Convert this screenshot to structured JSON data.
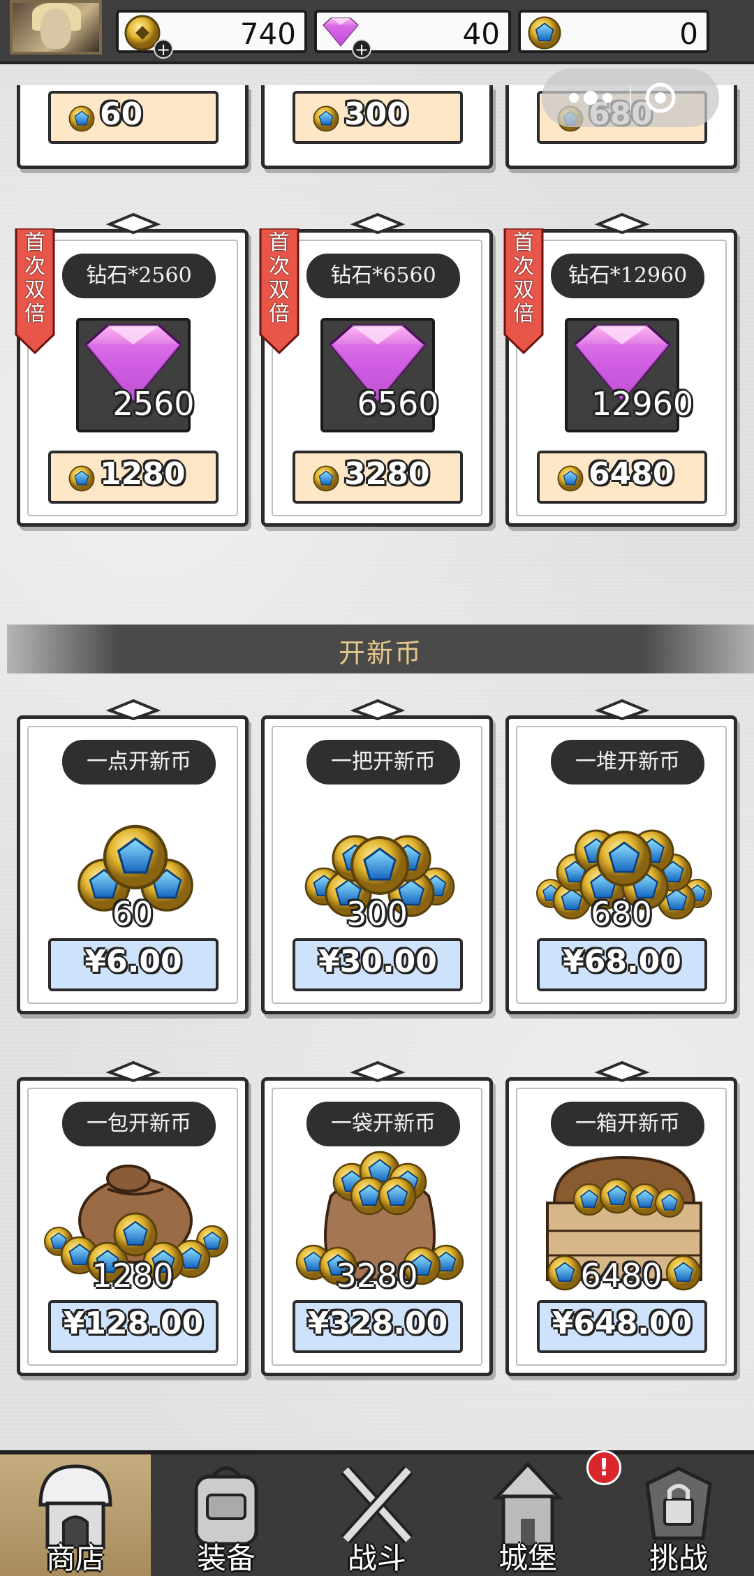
{
  "topbar": {
    "gold": "740",
    "diamond": "40",
    "kaixin_coin": "0",
    "plus": "+"
  },
  "first_double_label": "首次双倍",
  "partial_row": [
    {
      "price": "60"
    },
    {
      "price": "300"
    },
    {
      "price": "680"
    }
  ],
  "diamond_cards": [
    {
      "title": "钻石*2560",
      "amount": "2560",
      "price": "1280"
    },
    {
      "title": "钻石*6560",
      "amount": "6560",
      "price": "3280"
    },
    {
      "title": "钻石*12960",
      "amount": "12960",
      "price": "6480"
    }
  ],
  "section_title": "开新币",
  "coin_cards_row1": [
    {
      "title": "一点开新币",
      "amount": "60",
      "price": "¥6.00"
    },
    {
      "title": "一把开新币",
      "amount": "300",
      "price": "¥30.00"
    },
    {
      "title": "一堆开新币",
      "amount": "680",
      "price": "¥68.00"
    }
  ],
  "coin_cards_row2": [
    {
      "title": "一包开新币",
      "amount": "1280",
      "price": "¥128.00"
    },
    {
      "title": "一袋开新币",
      "amount": "3280",
      "price": "¥328.00"
    },
    {
      "title": "一箱开新币",
      "amount": "6480",
      "price": "¥648.00"
    }
  ],
  "bottom_nav": [
    {
      "label": "商店",
      "icon": "shop-icon"
    },
    {
      "label": "装备",
      "icon": "backpack-icon"
    },
    {
      "label": "战斗",
      "icon": "crossed-swords-icon"
    },
    {
      "label": "城堡",
      "icon": "castle-icon"
    },
    {
      "label": "挑战",
      "icon": "locked-armor-icon"
    }
  ],
  "nav_badge": "!",
  "colors": {
    "topbar": "#3e3e3e",
    "gold_price_bg": "#fde7c6",
    "blue_price_bg": "#cfe2fb",
    "ribbon": "#e8564a",
    "section_text": "#e8c88a",
    "active_nav": "#c5ad80"
  }
}
